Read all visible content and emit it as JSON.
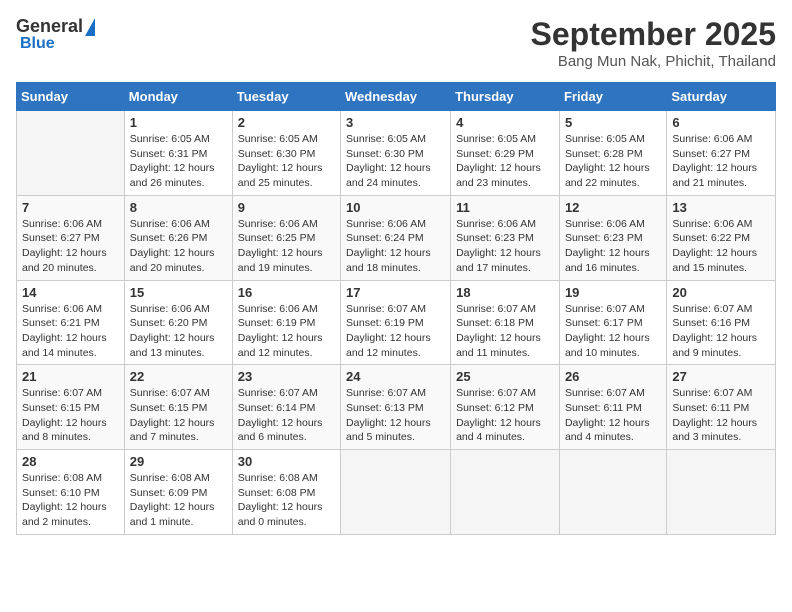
{
  "header": {
    "logo_general": "General",
    "logo_blue": "Blue",
    "month_title": "September 2025",
    "location": "Bang Mun Nak, Phichit, Thailand"
  },
  "days_of_week": [
    "Sunday",
    "Monday",
    "Tuesday",
    "Wednesday",
    "Thursday",
    "Friday",
    "Saturday"
  ],
  "weeks": [
    [
      {
        "day": "",
        "info": ""
      },
      {
        "day": "1",
        "info": "Sunrise: 6:05 AM\nSunset: 6:31 PM\nDaylight: 12 hours\nand 26 minutes."
      },
      {
        "day": "2",
        "info": "Sunrise: 6:05 AM\nSunset: 6:30 PM\nDaylight: 12 hours\nand 25 minutes."
      },
      {
        "day": "3",
        "info": "Sunrise: 6:05 AM\nSunset: 6:30 PM\nDaylight: 12 hours\nand 24 minutes."
      },
      {
        "day": "4",
        "info": "Sunrise: 6:05 AM\nSunset: 6:29 PM\nDaylight: 12 hours\nand 23 minutes."
      },
      {
        "day": "5",
        "info": "Sunrise: 6:05 AM\nSunset: 6:28 PM\nDaylight: 12 hours\nand 22 minutes."
      },
      {
        "day": "6",
        "info": "Sunrise: 6:06 AM\nSunset: 6:27 PM\nDaylight: 12 hours\nand 21 minutes."
      }
    ],
    [
      {
        "day": "7",
        "info": "Sunrise: 6:06 AM\nSunset: 6:27 PM\nDaylight: 12 hours\nand 20 minutes."
      },
      {
        "day": "8",
        "info": "Sunrise: 6:06 AM\nSunset: 6:26 PM\nDaylight: 12 hours\nand 20 minutes."
      },
      {
        "day": "9",
        "info": "Sunrise: 6:06 AM\nSunset: 6:25 PM\nDaylight: 12 hours\nand 19 minutes."
      },
      {
        "day": "10",
        "info": "Sunrise: 6:06 AM\nSunset: 6:24 PM\nDaylight: 12 hours\nand 18 minutes."
      },
      {
        "day": "11",
        "info": "Sunrise: 6:06 AM\nSunset: 6:23 PM\nDaylight: 12 hours\nand 17 minutes."
      },
      {
        "day": "12",
        "info": "Sunrise: 6:06 AM\nSunset: 6:23 PM\nDaylight: 12 hours\nand 16 minutes."
      },
      {
        "day": "13",
        "info": "Sunrise: 6:06 AM\nSunset: 6:22 PM\nDaylight: 12 hours\nand 15 minutes."
      }
    ],
    [
      {
        "day": "14",
        "info": "Sunrise: 6:06 AM\nSunset: 6:21 PM\nDaylight: 12 hours\nand 14 minutes."
      },
      {
        "day": "15",
        "info": "Sunrise: 6:06 AM\nSunset: 6:20 PM\nDaylight: 12 hours\nand 13 minutes."
      },
      {
        "day": "16",
        "info": "Sunrise: 6:06 AM\nSunset: 6:19 PM\nDaylight: 12 hours\nand 12 minutes."
      },
      {
        "day": "17",
        "info": "Sunrise: 6:07 AM\nSunset: 6:19 PM\nDaylight: 12 hours\nand 12 minutes."
      },
      {
        "day": "18",
        "info": "Sunrise: 6:07 AM\nSunset: 6:18 PM\nDaylight: 12 hours\nand 11 minutes."
      },
      {
        "day": "19",
        "info": "Sunrise: 6:07 AM\nSunset: 6:17 PM\nDaylight: 12 hours\nand 10 minutes."
      },
      {
        "day": "20",
        "info": "Sunrise: 6:07 AM\nSunset: 6:16 PM\nDaylight: 12 hours\nand 9 minutes."
      }
    ],
    [
      {
        "day": "21",
        "info": "Sunrise: 6:07 AM\nSunset: 6:15 PM\nDaylight: 12 hours\nand 8 minutes."
      },
      {
        "day": "22",
        "info": "Sunrise: 6:07 AM\nSunset: 6:15 PM\nDaylight: 12 hours\nand 7 minutes."
      },
      {
        "day": "23",
        "info": "Sunrise: 6:07 AM\nSunset: 6:14 PM\nDaylight: 12 hours\nand 6 minutes."
      },
      {
        "day": "24",
        "info": "Sunrise: 6:07 AM\nSunset: 6:13 PM\nDaylight: 12 hours\nand 5 minutes."
      },
      {
        "day": "25",
        "info": "Sunrise: 6:07 AM\nSunset: 6:12 PM\nDaylight: 12 hours\nand 4 minutes."
      },
      {
        "day": "26",
        "info": "Sunrise: 6:07 AM\nSunset: 6:11 PM\nDaylight: 12 hours\nand 4 minutes."
      },
      {
        "day": "27",
        "info": "Sunrise: 6:07 AM\nSunset: 6:11 PM\nDaylight: 12 hours\nand 3 minutes."
      }
    ],
    [
      {
        "day": "28",
        "info": "Sunrise: 6:08 AM\nSunset: 6:10 PM\nDaylight: 12 hours\nand 2 minutes."
      },
      {
        "day": "29",
        "info": "Sunrise: 6:08 AM\nSunset: 6:09 PM\nDaylight: 12 hours\nand 1 minute."
      },
      {
        "day": "30",
        "info": "Sunrise: 6:08 AM\nSunset: 6:08 PM\nDaylight: 12 hours\nand 0 minutes."
      },
      {
        "day": "",
        "info": ""
      },
      {
        "day": "",
        "info": ""
      },
      {
        "day": "",
        "info": ""
      },
      {
        "day": "",
        "info": ""
      }
    ]
  ]
}
